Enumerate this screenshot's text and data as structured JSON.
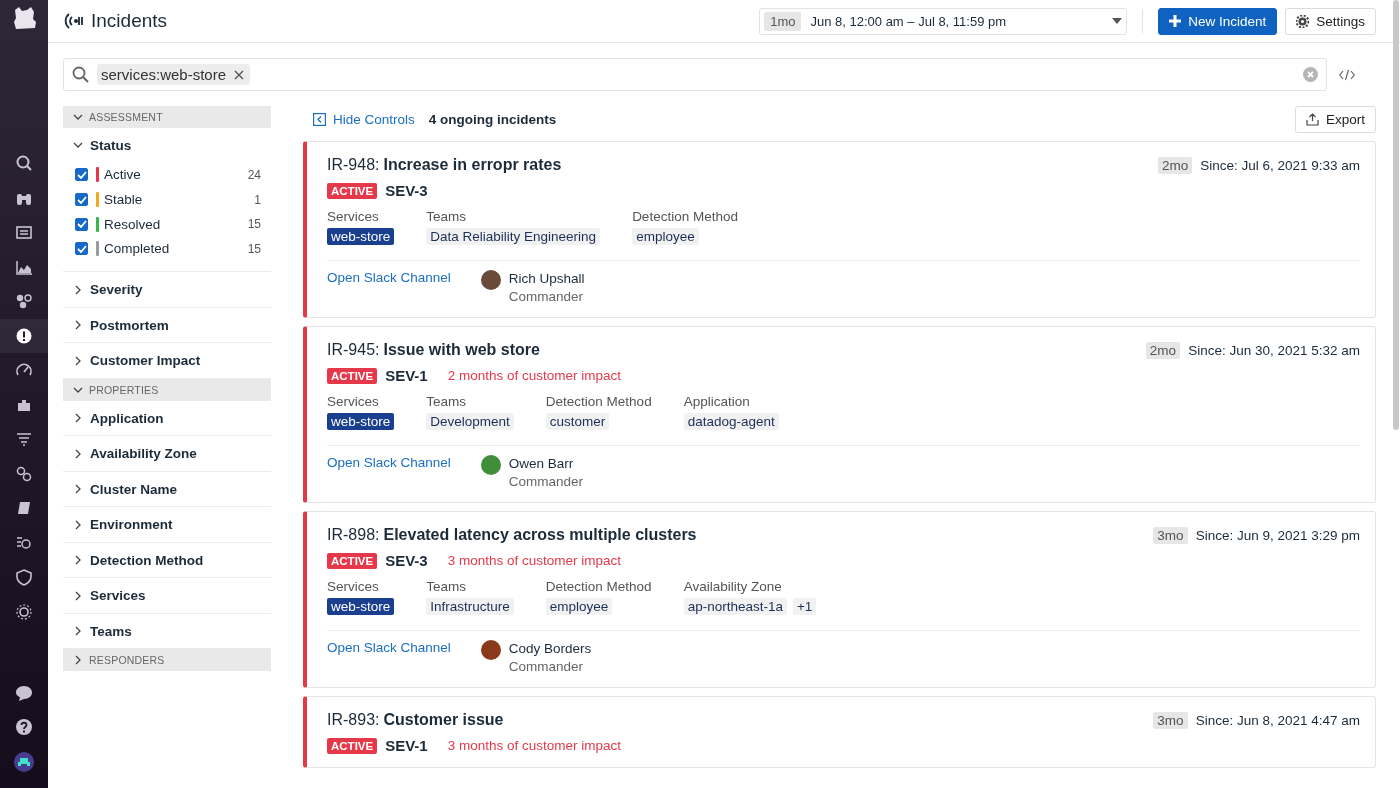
{
  "nav": {
    "items": [
      {
        "selected": false
      },
      {
        "selected": false
      },
      {
        "selected": false
      },
      {
        "selected": false
      },
      {
        "selected": false
      },
      {
        "selected": true
      },
      {
        "selected": false
      },
      {
        "selected": false
      },
      {
        "selected": false
      },
      {
        "selected": false
      },
      {
        "selected": false
      },
      {
        "selected": false
      },
      {
        "selected": false
      },
      {
        "selected": false
      }
    ]
  },
  "header": {
    "title": "Incidents",
    "range_badge": "1mo",
    "range": "Jun 8, 12:00 am – Jul 8, 11:59 pm",
    "new_button": "New Incident",
    "settings_button": "Settings"
  },
  "search": {
    "chips": [
      "services:web-store"
    ]
  },
  "facets": {
    "sections": [
      {
        "title": "ASSESSMENT",
        "expanded": true,
        "facets": [
          {
            "title": "Status",
            "expanded": true,
            "options": [
              {
                "label": "Active",
                "count": "24",
                "checked": true,
                "color": "#e5394b"
              },
              {
                "label": "Stable",
                "count": "1",
                "checked": true,
                "color": "#f5a623"
              },
              {
                "label": "Resolved",
                "count": "15",
                "checked": true,
                "color": "#3bb54a"
              },
              {
                "label": "Completed",
                "count": "15",
                "checked": true,
                "color": "#9a9a9e"
              }
            ]
          },
          {
            "title": "Severity",
            "expanded": false
          },
          {
            "title": "Postmortem",
            "expanded": false
          },
          {
            "title": "Customer Impact",
            "expanded": false
          }
        ]
      },
      {
        "title": "PROPERTIES",
        "expanded": true,
        "facets": [
          {
            "title": "Application",
            "expanded": false
          },
          {
            "title": "Availability Zone",
            "expanded": false
          },
          {
            "title": "Cluster Name",
            "expanded": false
          },
          {
            "title": "Environment",
            "expanded": false
          },
          {
            "title": "Detection Method",
            "expanded": false
          },
          {
            "title": "Services",
            "expanded": false
          },
          {
            "title": "Teams",
            "expanded": false
          }
        ]
      },
      {
        "title": "RESPONDERS",
        "expanded": false
      }
    ]
  },
  "toolbar": {
    "hide_controls": "Hide Controls",
    "count": "4 ongoing incidents",
    "export": "Export"
  },
  "incidents": [
    {
      "id": "IR-948:",
      "title": "Increase in erropr rates",
      "status": "ACTIVE",
      "severity": "SEV-3",
      "age": "2mo",
      "since": "Since: Jul 6, 2021 9:33 am",
      "fields": [
        {
          "label": "Services",
          "values": [
            {
              "text": "web-store",
              "highlighted": true
            }
          ]
        },
        {
          "label": "Teams",
          "values": [
            {
              "text": "Data Reliability Engineering",
              "highlighted": false
            }
          ]
        },
        {
          "label": "Detection Method",
          "values": [
            {
              "text": "employee",
              "highlighted": false
            }
          ]
        }
      ],
      "slack": "Open Slack Channel",
      "commander": "Rich Upshall",
      "role": "Commander"
    },
    {
      "id": "IR-945:",
      "title": "Issue with web store",
      "status": "ACTIVE",
      "severity": "SEV-1",
      "impact": "2 months of customer impact",
      "age": "2mo",
      "since": "Since: Jun 30, 2021 5:32 am",
      "fields": [
        {
          "label": "Services",
          "values": [
            {
              "text": "web-store",
              "highlighted": true
            }
          ]
        },
        {
          "label": "Teams",
          "values": [
            {
              "text": "Development",
              "highlighted": false
            }
          ]
        },
        {
          "label": "Detection Method",
          "values": [
            {
              "text": "customer",
              "highlighted": false
            }
          ]
        },
        {
          "label": "Application",
          "values": [
            {
              "text": "datadog-agent",
              "highlighted": false
            }
          ]
        }
      ],
      "slack": "Open Slack Channel",
      "commander": "Owen Barr",
      "role": "Commander"
    },
    {
      "id": "IR-898:",
      "title": "Elevated latency across multiple clusters",
      "status": "ACTIVE",
      "severity": "SEV-3",
      "impact": "3 months of customer impact",
      "age": "3mo",
      "since": "Since: Jun 9, 2021 3:29 pm",
      "fields": [
        {
          "label": "Services",
          "values": [
            {
              "text": "web-store",
              "highlighted": true
            }
          ]
        },
        {
          "label": "Teams",
          "values": [
            {
              "text": "Infrastructure",
              "highlighted": false
            }
          ]
        },
        {
          "label": "Detection Method",
          "values": [
            {
              "text": "employee",
              "highlighted": false
            }
          ]
        },
        {
          "label": "Availability Zone",
          "values": [
            {
              "text": "ap-northeast-1a",
              "highlighted": false
            },
            {
              "text": "+1",
              "highlighted": false
            }
          ]
        }
      ],
      "slack": "Open Slack Channel",
      "commander": "Cody Borders",
      "role": "Commander"
    },
    {
      "id": "IR-893:",
      "title": "Customer issue",
      "status": "ACTIVE",
      "severity": "SEV-1",
      "impact": "3 months of customer impact",
      "age": "3mo",
      "since": "Since: Jun 8, 2021 4:47 am"
    }
  ]
}
